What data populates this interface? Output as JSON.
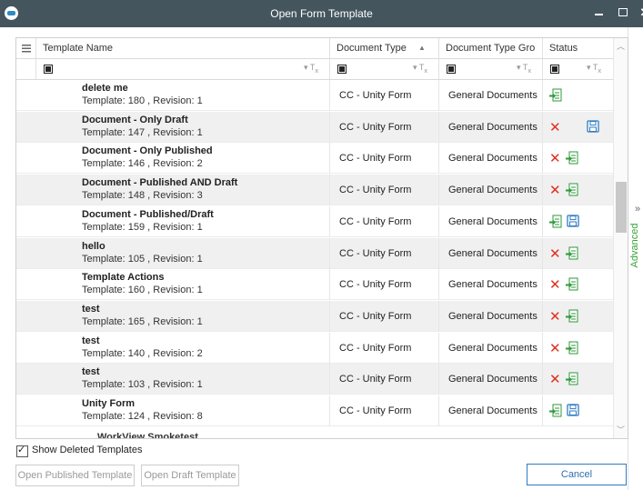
{
  "window": {
    "title": "Open Form Template"
  },
  "columns": [
    "Template Name",
    "Document Type",
    "Document Type Gro",
    "Status"
  ],
  "sort_indicator": "▲",
  "rows": [
    {
      "name": "delete me",
      "info": "Template: 180 , Revision: 1",
      "doc_type": "CC - Unity Form",
      "group": "General Documents",
      "status": [
        "publish"
      ]
    },
    {
      "name": "Document - Only Draft",
      "info": "Template: 147 , Revision: 1",
      "doc_type": "CC - Unity Form",
      "group": "General Documents",
      "status": [
        "delete",
        "draft"
      ]
    },
    {
      "name": "Document - Only Published",
      "info": "Template: 146 , Revision: 2",
      "doc_type": "CC - Unity Form",
      "group": "General Documents",
      "status": [
        "delete",
        "publish"
      ]
    },
    {
      "name": "Document - Published AND Draft",
      "info": "Template: 148 , Revision: 3",
      "doc_type": "CC - Unity Form",
      "group": "General Documents",
      "status": [
        "delete",
        "publish"
      ]
    },
    {
      "name": "Document - Published/Draft",
      "info": "Template: 159 , Revision: 1",
      "doc_type": "CC - Unity Form",
      "group": "General Documents",
      "status": [
        "publish",
        "draft"
      ]
    },
    {
      "name": "hello",
      "info": "Template: 105 , Revision: 1",
      "doc_type": "CC - Unity Form",
      "group": "General Documents",
      "status": [
        "delete",
        "publish"
      ]
    },
    {
      "name": "Template Actions",
      "info": "Template: 160 , Revision: 1",
      "doc_type": "CC - Unity Form",
      "group": "General Documents",
      "status": [
        "delete",
        "publish"
      ]
    },
    {
      "name": "test",
      "info": "Template: 165 , Revision: 1",
      "doc_type": "CC - Unity Form",
      "group": "General Documents",
      "status": [
        "delete",
        "publish"
      ]
    },
    {
      "name": "test",
      "info": "Template: 140 , Revision: 2",
      "doc_type": "CC - Unity Form",
      "group": "General Documents",
      "status": [
        "delete",
        "publish"
      ]
    },
    {
      "name": "test",
      "info": "Template: 103 , Revision: 1",
      "doc_type": "CC - Unity Form",
      "group": "General Documents",
      "status": [
        "delete",
        "publish"
      ]
    },
    {
      "name": "Unity Form",
      "info": "Template: 124 , Revision: 8",
      "doc_type": "CC - Unity Form",
      "group": "General Documents",
      "status": [
        "publish",
        "draft"
      ]
    }
  ],
  "partial_row": "WorkView Smoketest",
  "show_deleted": {
    "label": "Show Deleted Templates",
    "checked": true
  },
  "buttons": {
    "open_published": "Open Published Template",
    "open_draft": "Open Draft Template",
    "cancel": "Cancel"
  },
  "advanced": {
    "label": "Advanced",
    "arrow": "»"
  },
  "icons": {
    "delete": "red-x-icon",
    "publish": "publish-doc-icon",
    "draft": "floppy-save-icon",
    "filter": "filter-clear-icon",
    "column_chooser": "column-chooser-icon"
  },
  "colors": {
    "titlebar": "#44555e",
    "delete": "#e03020",
    "publish": "#2e9a3a",
    "draft": "#2f7bc0",
    "advanced": "#3aa33a"
  }
}
